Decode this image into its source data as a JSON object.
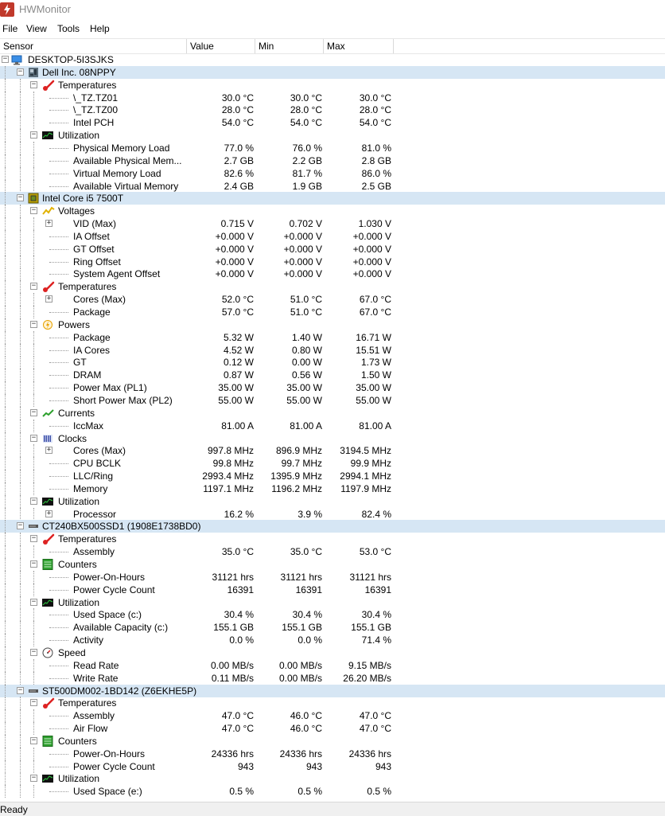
{
  "window": {
    "title": "HWMonitor"
  },
  "menu": [
    "File",
    "View",
    "Tools",
    "Help"
  ],
  "columns": {
    "sensor": "Sensor",
    "value": "Value",
    "min": "Min",
    "max": "Max"
  },
  "status": "Ready",
  "rows": [
    {
      "level": 0,
      "type": "root",
      "icon": "computer-icon",
      "label": "DESKTOP-5I3SJKS"
    },
    {
      "level": 1,
      "type": "device",
      "icon": "motherboard-icon",
      "label": "Dell Inc. 08NPPY"
    },
    {
      "level": 2,
      "type": "group",
      "icon": "thermometer-icon",
      "label": "Temperatures"
    },
    {
      "level": 3,
      "type": "sensor",
      "label": "\\_TZ.TZ01",
      "value": "30.0 °C",
      "min": "30.0 °C",
      "max": "30.0 °C"
    },
    {
      "level": 3,
      "type": "sensor",
      "label": "\\_TZ.TZ00",
      "value": "28.0 °C",
      "min": "28.0 °C",
      "max": "28.0 °C"
    },
    {
      "level": 3,
      "type": "sensor",
      "label": "Intel PCH",
      "value": "54.0 °C",
      "min": "54.0 °C",
      "max": "54.0 °C"
    },
    {
      "level": 2,
      "type": "group",
      "icon": "utilization-icon",
      "label": "Utilization"
    },
    {
      "level": 3,
      "type": "sensor",
      "label": "Physical Memory Load",
      "value": "77.0 %",
      "min": "76.0 %",
      "max": "81.0 %"
    },
    {
      "level": 3,
      "type": "sensor",
      "label": "Available Physical Mem...",
      "value": "2.7 GB",
      "min": "2.2 GB",
      "max": "2.8 GB"
    },
    {
      "level": 3,
      "type": "sensor",
      "label": "Virtual Memory Load",
      "value": "82.6 %",
      "min": "81.7 %",
      "max": "86.0 %"
    },
    {
      "level": 3,
      "type": "sensor",
      "label": "Available Virtual Memory",
      "value": "2.4 GB",
      "min": "1.9 GB",
      "max": "2.5 GB"
    },
    {
      "level": 1,
      "type": "device",
      "icon": "cpu-icon",
      "label": "Intel Core i5 7500T"
    },
    {
      "level": 2,
      "type": "group",
      "icon": "voltage-icon",
      "label": "Voltages"
    },
    {
      "level": 3,
      "type": "sensor",
      "expander": true,
      "label": "VID (Max)",
      "value": "0.715 V",
      "min": "0.702 V",
      "max": "1.030 V"
    },
    {
      "level": 3,
      "type": "sensor",
      "label": "IA Offset",
      "value": "+0.000 V",
      "min": "+0.000 V",
      "max": "+0.000 V"
    },
    {
      "level": 3,
      "type": "sensor",
      "label": "GT Offset",
      "value": "+0.000 V",
      "min": "+0.000 V",
      "max": "+0.000 V"
    },
    {
      "level": 3,
      "type": "sensor",
      "label": "Ring Offset",
      "value": "+0.000 V",
      "min": "+0.000 V",
      "max": "+0.000 V"
    },
    {
      "level": 3,
      "type": "sensor",
      "label": "System Agent Offset",
      "value": "+0.000 V",
      "min": "+0.000 V",
      "max": "+0.000 V"
    },
    {
      "level": 2,
      "type": "group",
      "icon": "thermometer-icon",
      "label": "Temperatures"
    },
    {
      "level": 3,
      "type": "sensor",
      "expander": true,
      "label": "Cores (Max)",
      "value": "52.0 °C",
      "min": "51.0 °C",
      "max": "67.0 °C"
    },
    {
      "level": 3,
      "type": "sensor",
      "label": "Package",
      "value": "57.0 °C",
      "min": "51.0 °C",
      "max": "67.0 °C"
    },
    {
      "level": 2,
      "type": "group",
      "icon": "power-icon",
      "label": "Powers"
    },
    {
      "level": 3,
      "type": "sensor",
      "label": "Package",
      "value": "5.32 W",
      "min": "1.40 W",
      "max": "16.71 W"
    },
    {
      "level": 3,
      "type": "sensor",
      "label": "IA Cores",
      "value": "4.52 W",
      "min": "0.80 W",
      "max": "15.51 W"
    },
    {
      "level": 3,
      "type": "sensor",
      "label": "GT",
      "value": "0.12 W",
      "min": "0.00 W",
      "max": "1.73 W"
    },
    {
      "level": 3,
      "type": "sensor",
      "label": "DRAM",
      "value": "0.87 W",
      "min": "0.56 W",
      "max": "1.50 W"
    },
    {
      "level": 3,
      "type": "sensor",
      "label": "Power Max (PL1)",
      "value": "35.00 W",
      "min": "35.00 W",
      "max": "35.00 W"
    },
    {
      "level": 3,
      "type": "sensor",
      "label": "Short Power Max (PL2)",
      "value": "55.00 W",
      "min": "55.00 W",
      "max": "55.00 W"
    },
    {
      "level": 2,
      "type": "group",
      "icon": "current-icon",
      "label": "Currents"
    },
    {
      "level": 3,
      "type": "sensor",
      "label": "IccMax",
      "value": "81.00 A",
      "min": "81.00 A",
      "max": "81.00 A"
    },
    {
      "level": 2,
      "type": "group",
      "icon": "clock-icon",
      "label": "Clocks"
    },
    {
      "level": 3,
      "type": "sensor",
      "expander": true,
      "label": "Cores (Max)",
      "value": "997.8 MHz",
      "min": "896.9 MHz",
      "max": "3194.5 MHz"
    },
    {
      "level": 3,
      "type": "sensor",
      "label": "CPU BCLK",
      "value": "99.8 MHz",
      "min": "99.7 MHz",
      "max": "99.9 MHz"
    },
    {
      "level": 3,
      "type": "sensor",
      "label": "LLC/Ring",
      "value": "2993.4 MHz",
      "min": "1395.9 MHz",
      "max": "2994.1 MHz"
    },
    {
      "level": 3,
      "type": "sensor",
      "label": "Memory",
      "value": "1197.1 MHz",
      "min": "1196.2 MHz",
      "max": "1197.9 MHz"
    },
    {
      "level": 2,
      "type": "group",
      "icon": "utilization-icon",
      "label": "Utilization"
    },
    {
      "level": 3,
      "type": "sensor",
      "expander": true,
      "label": "Processor",
      "value": "16.2 %",
      "min": "3.9 %",
      "max": "82.4 %"
    },
    {
      "level": 1,
      "type": "device",
      "icon": "drive-icon",
      "label": "CT240BX500SSD1 (1908E1738BD0)"
    },
    {
      "level": 2,
      "type": "group",
      "icon": "thermometer-icon",
      "label": "Temperatures"
    },
    {
      "level": 3,
      "type": "sensor",
      "label": "Assembly",
      "value": "35.0 °C",
      "min": "35.0 °C",
      "max": "53.0 °C"
    },
    {
      "level": 2,
      "type": "group",
      "icon": "counter-icon",
      "label": "Counters"
    },
    {
      "level": 3,
      "type": "sensor",
      "label": "Power-On-Hours",
      "value": "31121 hrs",
      "min": "31121 hrs",
      "max": "31121 hrs"
    },
    {
      "level": 3,
      "type": "sensor",
      "label": "Power Cycle Count",
      "value": "16391",
      "min": "16391",
      "max": "16391"
    },
    {
      "level": 2,
      "type": "group",
      "icon": "utilization-icon",
      "label": "Utilization"
    },
    {
      "level": 3,
      "type": "sensor",
      "label": "Used Space (c:)",
      "value": "30.4 %",
      "min": "30.4 %",
      "max": "30.4 %"
    },
    {
      "level": 3,
      "type": "sensor",
      "label": "Available Capacity (c:)",
      "value": "155.1 GB",
      "min": "155.1 GB",
      "max": "155.1 GB"
    },
    {
      "level": 3,
      "type": "sensor",
      "label": "Activity",
      "value": "0.0 %",
      "min": "0.0 %",
      "max": "71.4 %"
    },
    {
      "level": 2,
      "type": "group",
      "icon": "speed-icon",
      "label": "Speed"
    },
    {
      "level": 3,
      "type": "sensor",
      "label": "Read Rate",
      "value": "0.00 MB/s",
      "min": "0.00 MB/s",
      "max": "9.15 MB/s"
    },
    {
      "level": 3,
      "type": "sensor",
      "label": "Write Rate",
      "value": "0.11 MB/s",
      "min": "0.00 MB/s",
      "max": "26.20 MB/s"
    },
    {
      "level": 1,
      "type": "device",
      "icon": "drive-icon",
      "label": "ST500DM002-1BD142 (Z6EKHE5P)"
    },
    {
      "level": 2,
      "type": "group",
      "icon": "thermometer-icon",
      "label": "Temperatures"
    },
    {
      "level": 3,
      "type": "sensor",
      "label": "Assembly",
      "value": "47.0 °C",
      "min": "46.0 °C",
      "max": "47.0 °C"
    },
    {
      "level": 3,
      "type": "sensor",
      "label": "Air Flow",
      "value": "47.0 °C",
      "min": "46.0 °C",
      "max": "47.0 °C"
    },
    {
      "level": 2,
      "type": "group",
      "icon": "counter-icon",
      "label": "Counters"
    },
    {
      "level": 3,
      "type": "sensor",
      "label": "Power-On-Hours",
      "value": "24336 hrs",
      "min": "24336 hrs",
      "max": "24336 hrs"
    },
    {
      "level": 3,
      "type": "sensor",
      "label": "Power Cycle Count",
      "value": "943",
      "min": "943",
      "max": "943"
    },
    {
      "level": 2,
      "type": "group",
      "icon": "utilization-icon",
      "label": "Utilization"
    },
    {
      "level": 3,
      "type": "sensor",
      "label": "Used Space (e:)",
      "value": "0.5 %",
      "min": "0.5 %",
      "max": "0.5 %"
    }
  ]
}
